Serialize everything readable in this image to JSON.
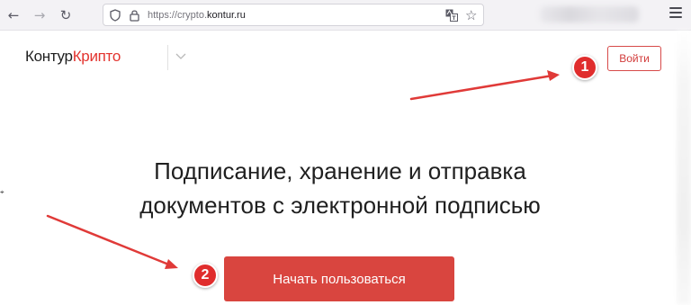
{
  "browser": {
    "url_prefix": "https://crypto.",
    "url_domain": "kontur.ru",
    "back_icon": "arrow-left-icon",
    "forward_icon": "arrow-right-icon",
    "reload_icon": "reload-icon",
    "menu_icon": "hamburger-menu-icon"
  },
  "header": {
    "logo_part1": "Контур",
    "logo_part2": "Крипто",
    "login_label": "Войти"
  },
  "hero": {
    "headline_line1": "Подписание, хранение и отправка",
    "headline_line2": "документов с электронной подписью",
    "cta_label": "Начать пользоваться"
  },
  "annotations": {
    "badge1": "1",
    "badge2": "2"
  },
  "colors": {
    "accent": "#d9453f",
    "badge": "#e02d2d",
    "arrow": "#e03a38"
  }
}
